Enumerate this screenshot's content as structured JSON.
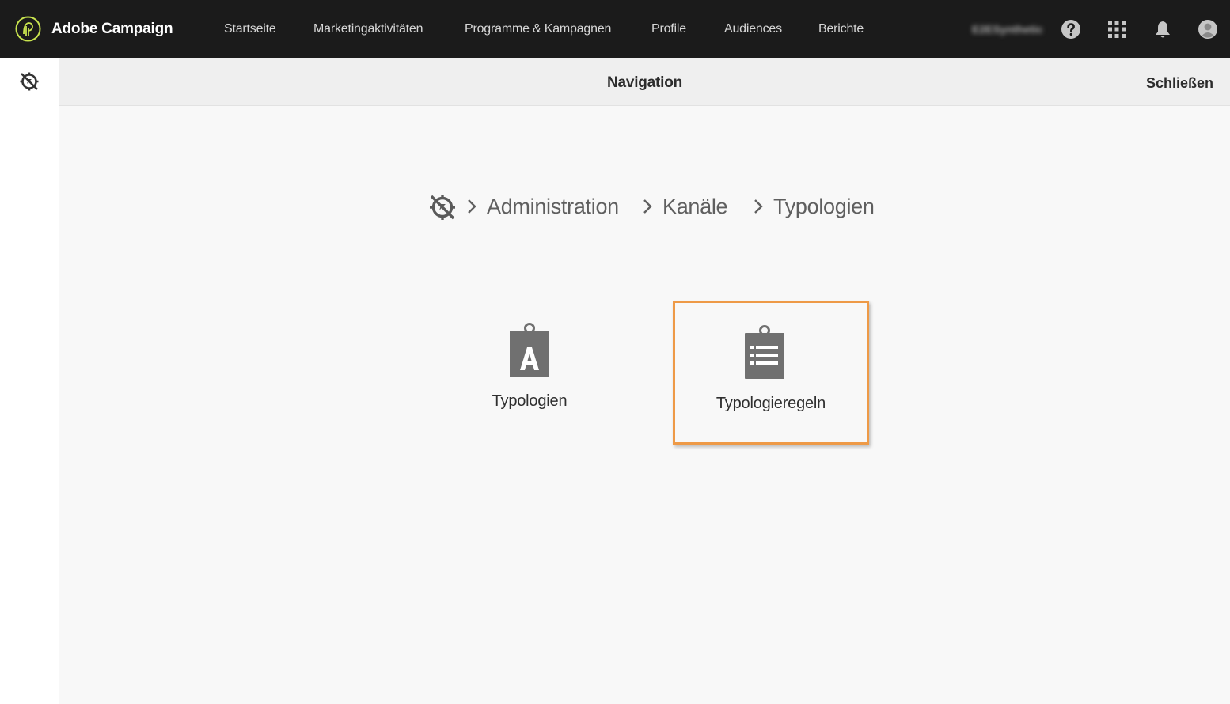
{
  "topbar": {
    "brand": "Adobe Campaign",
    "nav": [
      {
        "label": "Startseite"
      },
      {
        "label": "Marketingaktivitäten"
      },
      {
        "label": "Programme & Kampagnen"
      },
      {
        "label": "Profile"
      },
      {
        "label": "Audiences"
      },
      {
        "label": "Berichte"
      }
    ],
    "username": "E2ESynthetic",
    "icons": [
      "help-icon",
      "apps-grid-icon",
      "notification-bell-icon",
      "user-avatar-icon"
    ]
  },
  "header": {
    "title": "Navigation",
    "close_label": "Schließen"
  },
  "breadcrumb": {
    "items": [
      "Administration",
      "Kanäle",
      "Typologien"
    ]
  },
  "cards": [
    {
      "label": "Typologien",
      "icon": "clipboard-a-icon",
      "selected": false
    },
    {
      "label": "Typologieregeln",
      "icon": "clipboard-list-icon",
      "selected": true
    }
  ],
  "colors": {
    "topbar": "#1b1b1b",
    "accent_highlight": "#ee9a47",
    "brand_logo": "#c8e34e",
    "icon_gray": "#707070"
  }
}
